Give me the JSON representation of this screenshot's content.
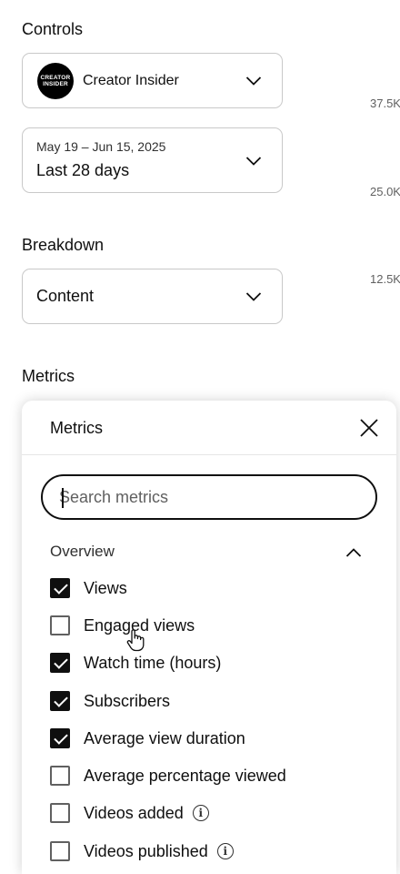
{
  "controls": {
    "title": "Controls",
    "channel": {
      "name": "Creator Insider",
      "logo_text": [
        "CREATOR",
        "INSIDER"
      ]
    },
    "date": {
      "range": "May 19 – Jun 15, 2025",
      "label": "Last 28 days"
    }
  },
  "breakdown": {
    "title": "Breakdown",
    "value": "Content"
  },
  "metrics_section": {
    "title": "Metrics"
  },
  "chart_axis": [
    "37.5K",
    "25.0K",
    "12.5K"
  ],
  "metrics_panel": {
    "title": "Metrics",
    "search_placeholder": "Search metrics",
    "group": "Overview",
    "items": [
      {
        "label": "Views",
        "checked": true
      },
      {
        "label": "Engaged views",
        "checked": false
      },
      {
        "label": "Watch time (hours)",
        "checked": true
      },
      {
        "label": "Subscribers",
        "checked": true
      },
      {
        "label": "Average view duration",
        "checked": true
      },
      {
        "label": "Average percentage viewed",
        "checked": false
      },
      {
        "label": "Videos added",
        "checked": false,
        "info": true
      },
      {
        "label": "Videos published",
        "checked": false,
        "info": true
      }
    ]
  },
  "icons": {
    "chevron": "chevron-down-icon",
    "close": "close-icon",
    "info": "info-icon",
    "cursor": "hand-cursor-icon"
  }
}
